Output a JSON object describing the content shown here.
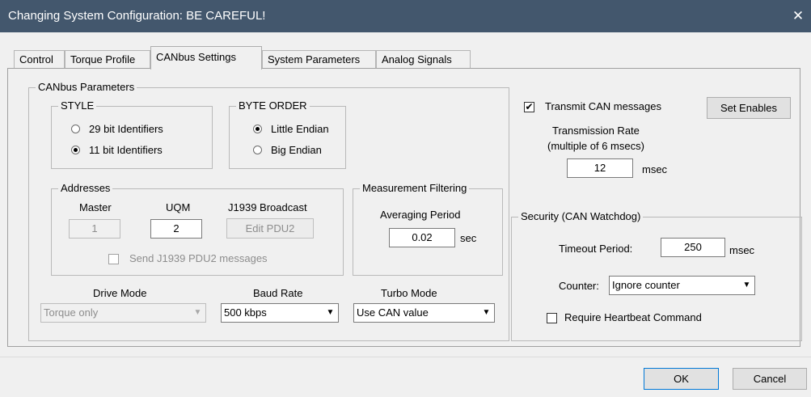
{
  "window": {
    "title": "Changing System Configuration: BE CAREFUL!",
    "close_glyph": "✕"
  },
  "tabs": [
    "Control",
    "Torque Profile",
    "CANbus Settings",
    "System Parameters",
    "Analog Signals"
  ],
  "canbus": {
    "group_label": "CANbus Parameters",
    "style": {
      "label": "STYLE",
      "options": [
        "29 bit Identifiers",
        "11 bit Identifiers"
      ],
      "selected": "11 bit Identifiers"
    },
    "byte_order": {
      "label": "BYTE ORDER",
      "options": [
        "Little Endian",
        "Big Endian"
      ],
      "selected": "Little Endian"
    },
    "addresses": {
      "label": "Addresses",
      "master_label": "Master",
      "master_value": "1",
      "uqm_label": "UQM",
      "uqm_value": "2",
      "broadcast_label": "J1939 Broadcast",
      "edit_pdu2": "Edit PDU2",
      "send_pdu2": "Send J1939 PDU2 messages"
    },
    "filtering": {
      "label": "Measurement Filtering",
      "avg_label": "Averaging Period",
      "avg_value": "0.02",
      "unit": "sec"
    },
    "drive_mode": {
      "label": "Drive Mode",
      "value": "Torque only"
    },
    "baud_rate": {
      "label": "Baud Rate",
      "value": "500 kbps"
    },
    "turbo_mode": {
      "label": "Turbo Mode",
      "value": "Use CAN value"
    },
    "transmit": {
      "label": "Transmit CAN messages",
      "checked": true,
      "set_enables": "Set Enables",
      "rate_line1": "Transmission Rate",
      "rate_line2": "(multiple of 6 msecs)",
      "rate_value": "12",
      "unit": "msec"
    },
    "security": {
      "label": "Security (CAN Watchdog)",
      "timeout_label": "Timeout Period:",
      "timeout_value": "250",
      "unit": "msec",
      "counter_label": "Counter:",
      "counter_value": "Ignore counter",
      "heartbeat": "Require Heartbeat Command"
    }
  },
  "footer": {
    "ok": "OK",
    "cancel": "Cancel"
  }
}
